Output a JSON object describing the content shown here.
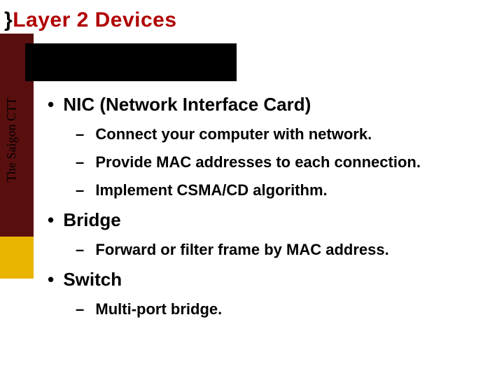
{
  "title": "Layer 2 Devices",
  "sidebar_text": "The Saigon CTT",
  "items": [
    {
      "label": "NIC (Network Interface Card)",
      "subs": [
        "Connect your computer with network.",
        "Provide MAC addresses to each connection.",
        "Implement CSMA/CD algorithm."
      ]
    },
    {
      "label": "Bridge",
      "subs": [
        "Forward or filter frame by MAC address."
      ]
    },
    {
      "label": "Switch",
      "subs": [
        "Multi-port bridge."
      ]
    }
  ]
}
